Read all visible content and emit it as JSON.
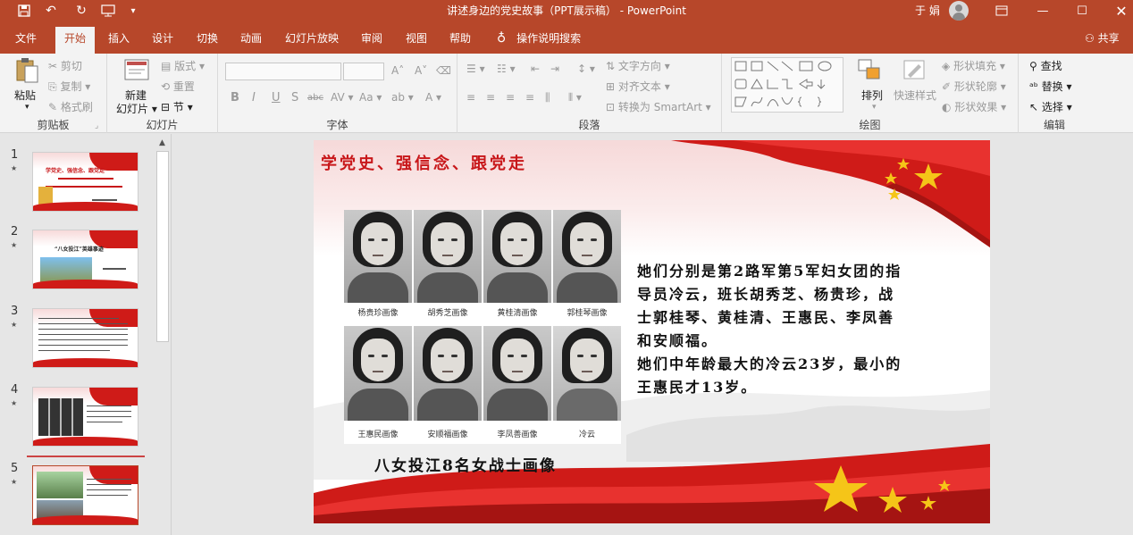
{
  "titlebar": {
    "doc_title": "讲述身边的党史故事（PPT展示稿） - PowerPoint",
    "user": "于 娟",
    "save_icon": "save-icon",
    "undo_icon": "undo-icon",
    "redo_icon": "redo-icon",
    "present_icon": "start-from-beginning-icon",
    "customize_icon": "customize-quick-access-icon"
  },
  "tabs": [
    "文件",
    "开始",
    "插入",
    "设计",
    "切换",
    "动画",
    "幻灯片放映",
    "审阅",
    "视图",
    "帮助"
  ],
  "active_tab": "开始",
  "tellme": "操作说明搜索",
  "share": "共享",
  "ribbon": {
    "clipboard": {
      "paste": "粘贴",
      "cut": "剪切",
      "copy": "复制",
      "format_painter": "格式刷",
      "label": "剪贴板"
    },
    "slides": {
      "new_slide": "新建",
      "new_slide2": "幻灯片",
      "layout": "版式",
      "reset": "重置",
      "section": "节",
      "label": "幻灯片"
    },
    "font": {
      "label": "字体"
    },
    "paragraph": {
      "text_direction": "文字方向",
      "align_text": "对齐文本",
      "smartart": "转换为 SmartArt",
      "label": "段落"
    },
    "drawing": {
      "arrange": "排列",
      "quick_styles": "快速样式",
      "shape_fill": "形状填充",
      "shape_outline": "形状轮廓",
      "shape_effects": "形状效果",
      "label": "绘图"
    },
    "editing": {
      "find": "查找",
      "replace": "替换",
      "select": "选择",
      "label": "编辑"
    }
  },
  "thumbnails": [
    {
      "num": "1",
      "title": "学党史、强信念、跟党走"
    },
    {
      "num": "2",
      "title": "“八女投江”英雄事迹"
    },
    {
      "num": "3",
      "title": ""
    },
    {
      "num": "4",
      "title": ""
    },
    {
      "num": "5",
      "title": ""
    }
  ],
  "slide": {
    "title": "学党史、强信念、跟党走",
    "portraits": [
      "杨贵珍画像",
      "胡秀芝画像",
      "黄桂清画像",
      "郭桂琴画像",
      "王惠民画像",
      "安顺福画像",
      "李凤善画像",
      "冷云"
    ],
    "caption": "八女投江8名女战士画像",
    "body": [
      "她们分别是第2路军第5军妇女团的指",
      "导员冷云，班长胡秀芝、杨贵珍，战",
      "士郭桂琴、黄桂清、王惠民、李凤善",
      "和安顺福。",
      "她们中年龄最大的冷云23岁，最小的",
      "王惠民才13岁。"
    ]
  },
  "colors": {
    "accent": "#b7472a",
    "flag_red": "#cf1b18",
    "star_gold": "#f5c518"
  }
}
